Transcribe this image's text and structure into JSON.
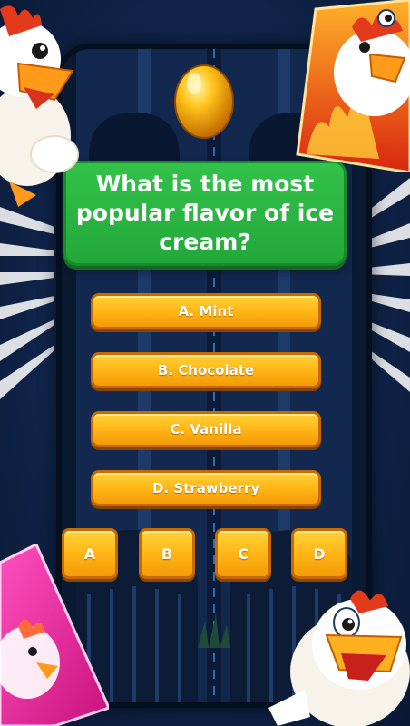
{
  "question": {
    "text": "What is the most popular flavor of ice cream?"
  },
  "answers": [
    {
      "label": "A. Mint"
    },
    {
      "label": "B. Chocolate"
    },
    {
      "label": "C. Vanilla"
    },
    {
      "label": "D. Strawberry"
    }
  ],
  "letter_buttons": [
    "A",
    "B",
    "C",
    "D"
  ],
  "colors": {
    "background": "#10244a",
    "question_green": "#2bb842",
    "answer_orange": "#ffb616",
    "egg_gold": "#ffb000",
    "fire_card": "#e8431a",
    "pink_card": "#ff2fa8"
  },
  "icons": [
    "golden-egg-icon",
    "chicken-mascot-icon",
    "fire-chicken-card-icon",
    "pink-chicken-card-icon"
  ]
}
